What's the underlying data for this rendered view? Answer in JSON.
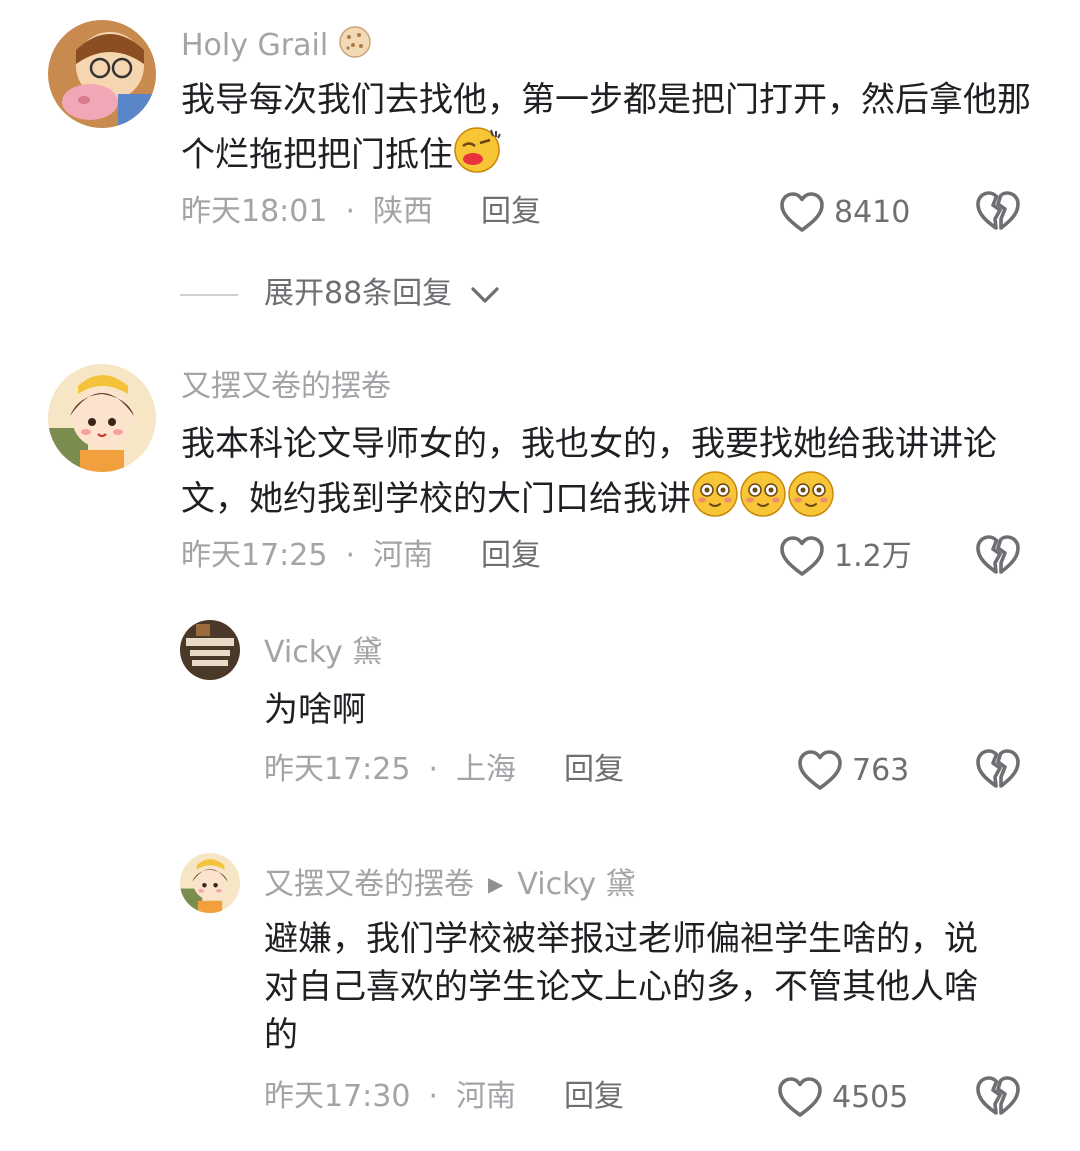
{
  "comments": [
    {
      "username": "Holy Grail",
      "username_emoji": "cookie-emoji",
      "text": "我导每次我们去找他，第一步都是把门打开，然后拿他那个烂拖把把门抵住",
      "text_emoji": "kiss-emoji",
      "time": "昨天18:01",
      "location": "陕西",
      "reply_label": "回复",
      "likes": "8410",
      "expand_label": "展开88条回复"
    },
    {
      "username": "又摆又卷的摆卷",
      "text": "我本科论文导师女的，我也女的，我要找她给我讲讲论文，她约我到学校的大门口给我讲",
      "text_emoji": "flushed-emoji ×3",
      "time": "昨天17:25",
      "location": "河南",
      "reply_label": "回复",
      "likes": "1.2万"
    }
  ],
  "replies": [
    {
      "username": "Vicky 黛",
      "text": "为啥啊",
      "time": "昨天17:25",
      "location": "上海",
      "reply_label": "回复",
      "likes": "763"
    },
    {
      "username": "又摆又卷的摆卷",
      "reply_to": "Vicky 黛",
      "text_line1": "避嫌，我们学校被举报过老师偏袒学生啥的，说",
      "text_line2": "对自己喜欢的学生论文上心的多，不管其他人啥",
      "text_line3": "的",
      "time": "昨天17:30",
      "location": "河南",
      "reply_label": "回复",
      "likes": "4505"
    }
  ],
  "separator": "·",
  "icons": {
    "like": "heart-outline-icon",
    "dislike": "broken-heart-icon",
    "expand": "chevron-down-icon",
    "reply_arrow": "play-arrow-icon"
  },
  "colors": {
    "text": "#1f1f24",
    "muted": "#a3a3a8",
    "action": "#6e6e73",
    "emoji": "#f8c537"
  }
}
